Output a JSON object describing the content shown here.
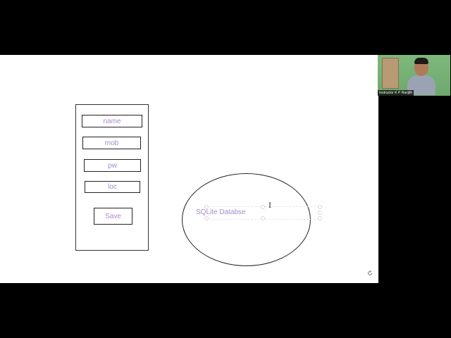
{
  "whiteboard": {
    "form": {
      "fields": [
        {
          "label": "name"
        },
        {
          "label": "mob"
        },
        {
          "label": "pw"
        },
        {
          "label": "loc"
        }
      ],
      "save_label": "Save"
    },
    "database": {
      "label": "SQLite Databse"
    },
    "text_cursor": "I",
    "corner_icon": "refresh-icon"
  },
  "webcam": {
    "participant_label": "Instructor K P Ranjith"
  },
  "colors": {
    "background": "#000000",
    "whiteboard": "#ffffff",
    "text_accent": "#a78bc9",
    "stroke": "#222222"
  }
}
